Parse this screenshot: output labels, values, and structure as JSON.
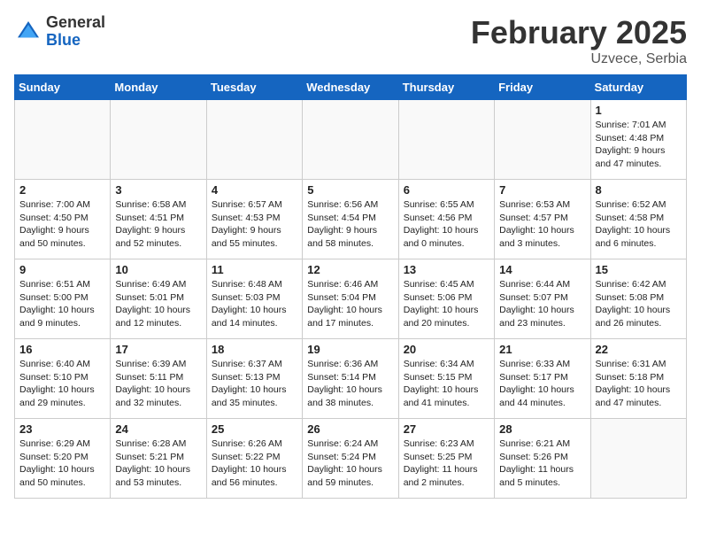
{
  "header": {
    "logo_general": "General",
    "logo_blue": "Blue",
    "month_title": "February 2025",
    "location": "Uzvece, Serbia"
  },
  "days_of_week": [
    "Sunday",
    "Monday",
    "Tuesday",
    "Wednesday",
    "Thursday",
    "Friday",
    "Saturday"
  ],
  "weeks": [
    [
      {
        "day": "",
        "info": ""
      },
      {
        "day": "",
        "info": ""
      },
      {
        "day": "",
        "info": ""
      },
      {
        "day": "",
        "info": ""
      },
      {
        "day": "",
        "info": ""
      },
      {
        "day": "",
        "info": ""
      },
      {
        "day": "1",
        "info": "Sunrise: 7:01 AM\nSunset: 4:48 PM\nDaylight: 9 hours and 47 minutes."
      }
    ],
    [
      {
        "day": "2",
        "info": "Sunrise: 7:00 AM\nSunset: 4:50 PM\nDaylight: 9 hours and 50 minutes."
      },
      {
        "day": "3",
        "info": "Sunrise: 6:58 AM\nSunset: 4:51 PM\nDaylight: 9 hours and 52 minutes."
      },
      {
        "day": "4",
        "info": "Sunrise: 6:57 AM\nSunset: 4:53 PM\nDaylight: 9 hours and 55 minutes."
      },
      {
        "day": "5",
        "info": "Sunrise: 6:56 AM\nSunset: 4:54 PM\nDaylight: 9 hours and 58 minutes."
      },
      {
        "day": "6",
        "info": "Sunrise: 6:55 AM\nSunset: 4:56 PM\nDaylight: 10 hours and 0 minutes."
      },
      {
        "day": "7",
        "info": "Sunrise: 6:53 AM\nSunset: 4:57 PM\nDaylight: 10 hours and 3 minutes."
      },
      {
        "day": "8",
        "info": "Sunrise: 6:52 AM\nSunset: 4:58 PM\nDaylight: 10 hours and 6 minutes."
      }
    ],
    [
      {
        "day": "9",
        "info": "Sunrise: 6:51 AM\nSunset: 5:00 PM\nDaylight: 10 hours and 9 minutes."
      },
      {
        "day": "10",
        "info": "Sunrise: 6:49 AM\nSunset: 5:01 PM\nDaylight: 10 hours and 12 minutes."
      },
      {
        "day": "11",
        "info": "Sunrise: 6:48 AM\nSunset: 5:03 PM\nDaylight: 10 hours and 14 minutes."
      },
      {
        "day": "12",
        "info": "Sunrise: 6:46 AM\nSunset: 5:04 PM\nDaylight: 10 hours and 17 minutes."
      },
      {
        "day": "13",
        "info": "Sunrise: 6:45 AM\nSunset: 5:06 PM\nDaylight: 10 hours and 20 minutes."
      },
      {
        "day": "14",
        "info": "Sunrise: 6:44 AM\nSunset: 5:07 PM\nDaylight: 10 hours and 23 minutes."
      },
      {
        "day": "15",
        "info": "Sunrise: 6:42 AM\nSunset: 5:08 PM\nDaylight: 10 hours and 26 minutes."
      }
    ],
    [
      {
        "day": "16",
        "info": "Sunrise: 6:40 AM\nSunset: 5:10 PM\nDaylight: 10 hours and 29 minutes."
      },
      {
        "day": "17",
        "info": "Sunrise: 6:39 AM\nSunset: 5:11 PM\nDaylight: 10 hours and 32 minutes."
      },
      {
        "day": "18",
        "info": "Sunrise: 6:37 AM\nSunset: 5:13 PM\nDaylight: 10 hours and 35 minutes."
      },
      {
        "day": "19",
        "info": "Sunrise: 6:36 AM\nSunset: 5:14 PM\nDaylight: 10 hours and 38 minutes."
      },
      {
        "day": "20",
        "info": "Sunrise: 6:34 AM\nSunset: 5:15 PM\nDaylight: 10 hours and 41 minutes."
      },
      {
        "day": "21",
        "info": "Sunrise: 6:33 AM\nSunset: 5:17 PM\nDaylight: 10 hours and 44 minutes."
      },
      {
        "day": "22",
        "info": "Sunrise: 6:31 AM\nSunset: 5:18 PM\nDaylight: 10 hours and 47 minutes."
      }
    ],
    [
      {
        "day": "23",
        "info": "Sunrise: 6:29 AM\nSunset: 5:20 PM\nDaylight: 10 hours and 50 minutes."
      },
      {
        "day": "24",
        "info": "Sunrise: 6:28 AM\nSunset: 5:21 PM\nDaylight: 10 hours and 53 minutes."
      },
      {
        "day": "25",
        "info": "Sunrise: 6:26 AM\nSunset: 5:22 PM\nDaylight: 10 hours and 56 minutes."
      },
      {
        "day": "26",
        "info": "Sunrise: 6:24 AM\nSunset: 5:24 PM\nDaylight: 10 hours and 59 minutes."
      },
      {
        "day": "27",
        "info": "Sunrise: 6:23 AM\nSunset: 5:25 PM\nDaylight: 11 hours and 2 minutes."
      },
      {
        "day": "28",
        "info": "Sunrise: 6:21 AM\nSunset: 5:26 PM\nDaylight: 11 hours and 5 minutes."
      },
      {
        "day": "",
        "info": ""
      }
    ]
  ]
}
